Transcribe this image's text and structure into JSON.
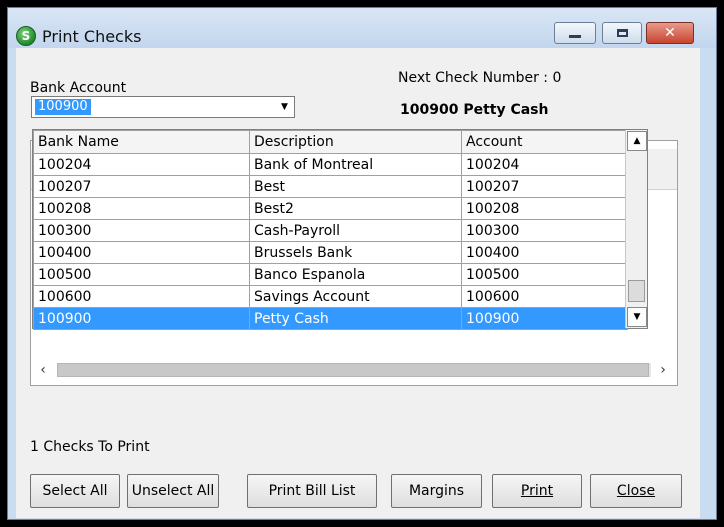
{
  "window": {
    "title": "Print Checks",
    "app_icon_letter": "S"
  },
  "form": {
    "bank_account_label": "Bank Account",
    "bank_account_value": "100900",
    "next_check_label": "Next Check Number : 0",
    "selected_account_desc": "100900 Petty Cash",
    "checks_to_print": "1 Checks To Print"
  },
  "grid": {
    "columns": [
      "Bank Name",
      "Description",
      "Account"
    ],
    "rows": [
      {
        "bank_name": "100204",
        "description": "Bank of Montreal",
        "account": "100204",
        "selected": false
      },
      {
        "bank_name": "100207",
        "description": "Best",
        "account": "100207",
        "selected": false
      },
      {
        "bank_name": "100208",
        "description": "Best2",
        "account": "100208",
        "selected": false
      },
      {
        "bank_name": "100300",
        "description": "Cash-Payroll",
        "account": "100300",
        "selected": false
      },
      {
        "bank_name": "100400",
        "description": "Brussels Bank",
        "account": "100400",
        "selected": false
      },
      {
        "bank_name": "100500",
        "description": "Banco Espanola",
        "account": "100500",
        "selected": false
      },
      {
        "bank_name": "100600",
        "description": "Savings Account",
        "account": "100600",
        "selected": false
      },
      {
        "bank_name": "100900",
        "description": "Petty Cash",
        "account": "100900",
        "selected": true
      }
    ]
  },
  "buttons": {
    "select_all": "Select All",
    "unselect_all": "Unselect All",
    "print_bill_list": "Print Bill List",
    "margins": "Margins",
    "print": "Print",
    "close": "Close"
  },
  "colors": {
    "selection": "#3399ff",
    "title_bar": "#c9dcf0",
    "close_button": "#c8442f"
  }
}
